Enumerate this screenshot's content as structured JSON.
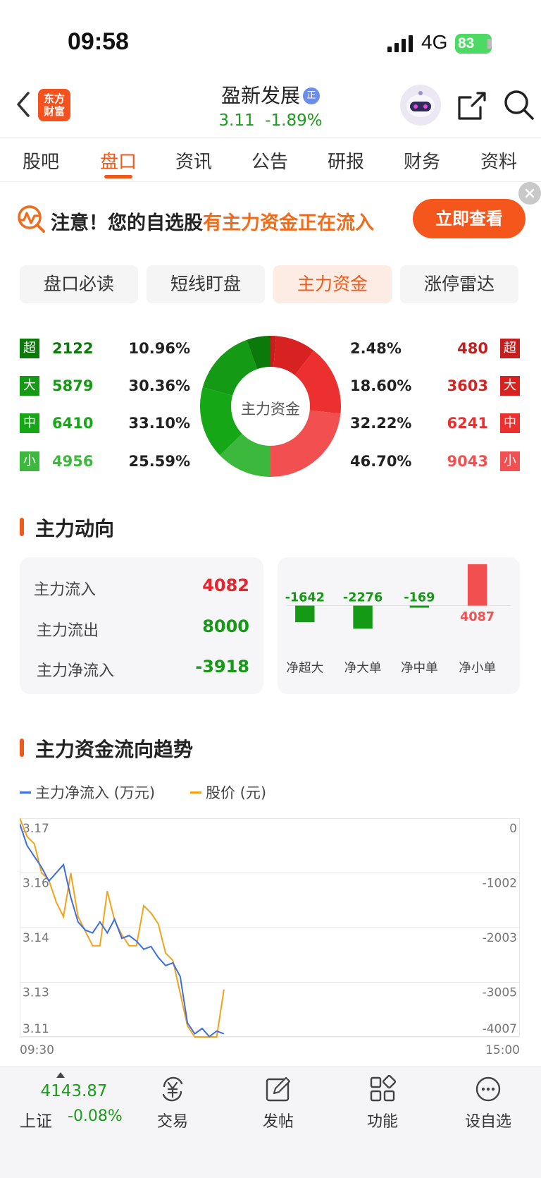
{
  "status": {
    "time": "09:58",
    "network": "4G",
    "battery": "83"
  },
  "header": {
    "logo_line1": "东方",
    "logo_line2": "财富",
    "stock_name": "盈新发展",
    "stock_badge": "正",
    "price": "3.11",
    "change_pct": "-1.89%"
  },
  "tabs": [
    "股吧",
    "盘口",
    "资讯",
    "公告",
    "研报",
    "财务",
    "资料"
  ],
  "banner": {
    "text_prefix": "注意！您的自选股",
    "text_highlight": "有主力资金正在流入",
    "button": "立即查看"
  },
  "segments": [
    "盘口必读",
    "短线盯盘",
    "主力资金",
    "涨停雷达"
  ],
  "flow": {
    "center_label": "主力资金",
    "outflow": [
      {
        "badge": "超",
        "value": "2122",
        "pct": "10.96%",
        "color": "#0b7a0b"
      },
      {
        "badge": "大",
        "value": "5879",
        "pct": "30.36%",
        "color": "#149a14"
      },
      {
        "badge": "中",
        "value": "6410",
        "pct": "33.10%",
        "color": "#16a716"
      },
      {
        "badge": "小",
        "value": "4956",
        "pct": "25.59%",
        "color": "#3cb83c"
      }
    ],
    "inflow": [
      {
        "badge": "超",
        "value": "480",
        "pct": "2.48%",
        "color": "#c41e1e"
      },
      {
        "badge": "大",
        "value": "3603",
        "pct": "18.60%",
        "color": "#d82222"
      },
      {
        "badge": "中",
        "value": "6241",
        "pct": "32.22%",
        "color": "#ec2f2f"
      },
      {
        "badge": "小",
        "value": "9043",
        "pct": "46.70%",
        "color": "#f25050"
      }
    ]
  },
  "main_direction": {
    "title": "主力动向",
    "rows": [
      {
        "label": "主力流入",
        "value": "4082",
        "color": "#e8232b"
      },
      {
        "label": "主力流出",
        "value": "8000",
        "color": "#149a14"
      },
      {
        "label": "主力净流入",
        "value": "-3918",
        "color": "#149a14"
      }
    ]
  },
  "chart_data": [
    {
      "type": "bar",
      "categories": [
        "净超大",
        "净大单",
        "净中单",
        "净小单"
      ],
      "values": [
        -1642,
        -2276,
        -169,
        4087
      ],
      "value_labels": [
        "-1642",
        "-2276",
        "-169",
        "4087"
      ],
      "colors": {
        "positive": "#f25050",
        "negative": "#149a14"
      }
    },
    {
      "type": "line",
      "title": "主力资金流向趋势",
      "x_start_label": "09:30",
      "x_end_label": "15:00",
      "left_ticks": [
        "3.17",
        "3.16",
        "3.14",
        "3.13",
        "3.11"
      ],
      "right_ticks": [
        "0",
        "-1002",
        "-2003",
        "-3005",
        "-4007"
      ],
      "ylim_price": [
        3.11,
        3.17
      ],
      "ylim_flow": [
        -4007,
        0
      ],
      "series": [
        {
          "name": "主力净流入 (万元)",
          "color": "#3d6ee0",
          "values": [
            -100,
            -500,
            -700,
            -900,
            -1150,
            -1000,
            -850,
            -1450,
            -1900,
            -2050,
            -2100,
            -1900,
            -2100,
            -1850,
            -2200,
            -2150,
            -2250,
            -2400,
            -2350,
            -2550,
            -2700,
            -2650,
            -2900,
            -3750,
            -3950,
            -3850,
            -4000,
            -3900,
            -3950
          ]
        },
        {
          "name": "股价 (元)",
          "color": "#f4a21a",
          "values": [
            3.17,
            3.165,
            3.163,
            3.155,
            3.153,
            3.147,
            3.143,
            3.155,
            3.143,
            3.139,
            3.135,
            3.135,
            3.15,
            3.142,
            3.138,
            3.135,
            3.135,
            3.146,
            3.144,
            3.141,
            3.133,
            3.131,
            3.122,
            3.113,
            3.11,
            3.11,
            3.11,
            3.11,
            3.123
          ]
        }
      ]
    }
  ],
  "trend": {
    "title": "主力资金流向趋势",
    "legend_flow": "主力净流入 (万元)",
    "legend_price": "股价 (元)"
  },
  "bottom": {
    "index_value": "4143.87",
    "index_name": "上证",
    "index_change": "-0.08%",
    "items": [
      "交易",
      "发帖",
      "功能",
      "设自选"
    ]
  }
}
